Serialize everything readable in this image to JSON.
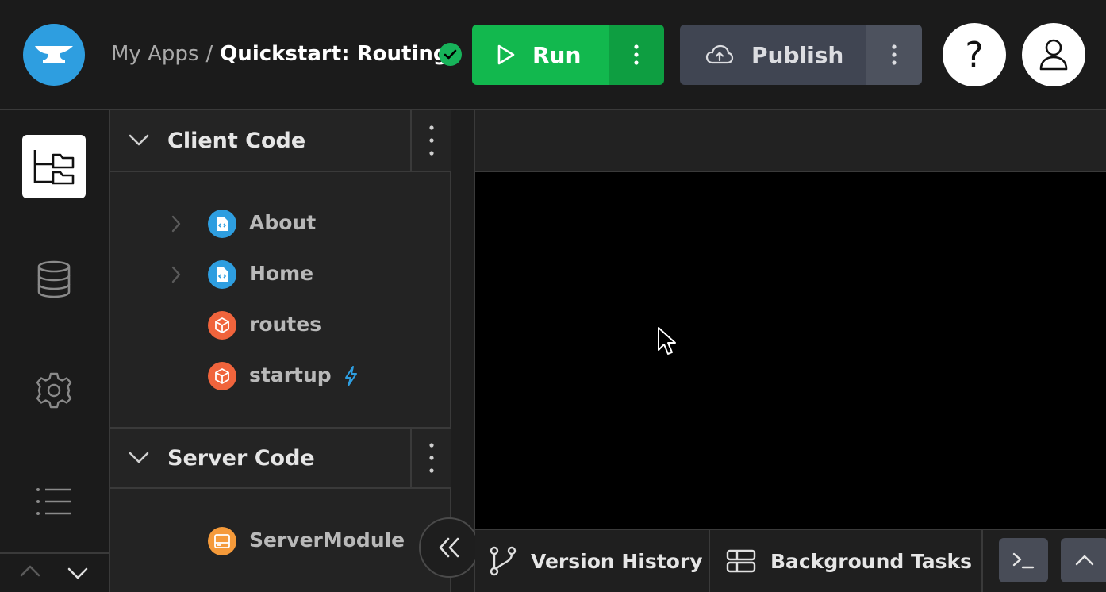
{
  "header": {
    "breadcrumb_root": "My Apps",
    "breadcrumb_separator": "/",
    "app_name": "Quickstart: Routing",
    "run_label": "Run",
    "publish_label": "Publish",
    "help_label": "?"
  },
  "rail": {
    "items": [
      "files-icon",
      "database-icon",
      "settings-icon",
      "list-icon"
    ]
  },
  "explorer": {
    "client_section": {
      "title": "Client Code",
      "items": [
        {
          "label": "About",
          "icon": "form-icon",
          "color": "#2e9ee0",
          "expandable": true
        },
        {
          "label": "Home",
          "icon": "form-icon",
          "color": "#2e9ee0",
          "expandable": true
        },
        {
          "label": "routes",
          "icon": "module-icon",
          "color": "#f0643c",
          "expandable": false
        },
        {
          "label": "startup",
          "icon": "module-icon",
          "color": "#f0643c",
          "expandable": false,
          "startup_flag": true
        }
      ]
    },
    "server_section": {
      "title": "Server Code",
      "items": [
        {
          "label": "ServerModule",
          "icon": "server-module-icon",
          "color": "#f59a3a",
          "expandable": false
        }
      ]
    }
  },
  "bottom_bar": {
    "version_history_label": "Version History",
    "background_tasks_label": "Background Tasks"
  },
  "colors": {
    "run_green": "#12b84e",
    "publish_gray": "#404552",
    "accent_blue": "#2e9ee0",
    "module_orange": "#f0643c"
  }
}
